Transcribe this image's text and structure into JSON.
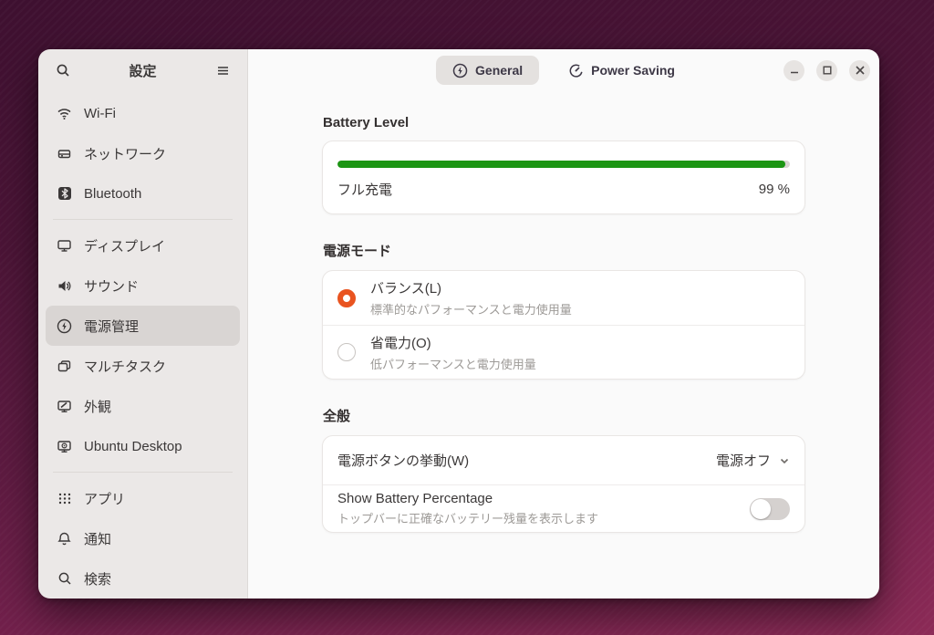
{
  "window": {
    "title": "設定",
    "tabs": [
      {
        "label": "General",
        "icon": "power-icon",
        "selected": true
      },
      {
        "label": "Power Saving",
        "icon": "gauge-icon",
        "selected": false
      }
    ]
  },
  "sidebar": {
    "items": [
      {
        "label": "Wi-Fi",
        "icon": "wifi-icon"
      },
      {
        "label": "ネットワーク",
        "icon": "network-icon"
      },
      {
        "label": "Bluetooth",
        "icon": "bluetooth-icon"
      },
      {
        "label": "ディスプレイ",
        "icon": "display-icon"
      },
      {
        "label": "サウンド",
        "icon": "speaker-icon"
      },
      {
        "label": "電源管理",
        "icon": "power-icon",
        "selected": true
      },
      {
        "label": "マルチタスク",
        "icon": "multitask-icon"
      },
      {
        "label": "外観",
        "icon": "appearance-icon"
      },
      {
        "label": "Ubuntu Desktop",
        "icon": "ubuntu-desktop-icon"
      },
      {
        "label": "アプリ",
        "icon": "apps-grid-icon"
      },
      {
        "label": "通知",
        "icon": "bell-icon"
      },
      {
        "label": "検索",
        "icon": "search-icon"
      }
    ]
  },
  "battery": {
    "section_title": "Battery Level",
    "status": "フル充電",
    "percent_label": "99 %",
    "percent_value": 99,
    "bar_color": "#1c9514"
  },
  "power_mode": {
    "section_title": "電源モード",
    "options": [
      {
        "label": "バランス(L)",
        "description": "標準的なパフォーマンスと電力使用量",
        "selected": true
      },
      {
        "label": "省電力(O)",
        "description": "低パフォーマンスと電力使用量",
        "selected": false
      }
    ]
  },
  "general": {
    "section_title": "全般",
    "power_button_row": {
      "label": "電源ボタンの挙動(W)",
      "value": "電源オフ"
    },
    "battery_percentage_row": {
      "label": "Show Battery Percentage",
      "description": "トップバーに正確なバッテリー残量を表示します",
      "enabled": false
    }
  },
  "colors": {
    "accent_orange": "#e95420",
    "progress_green": "#1c9514",
    "desktop_top": "#3e1030",
    "desktop_bottom": "#8c2b57",
    "sidebar_bg": "#ebe8e7",
    "main_bg": "#fafafa"
  }
}
